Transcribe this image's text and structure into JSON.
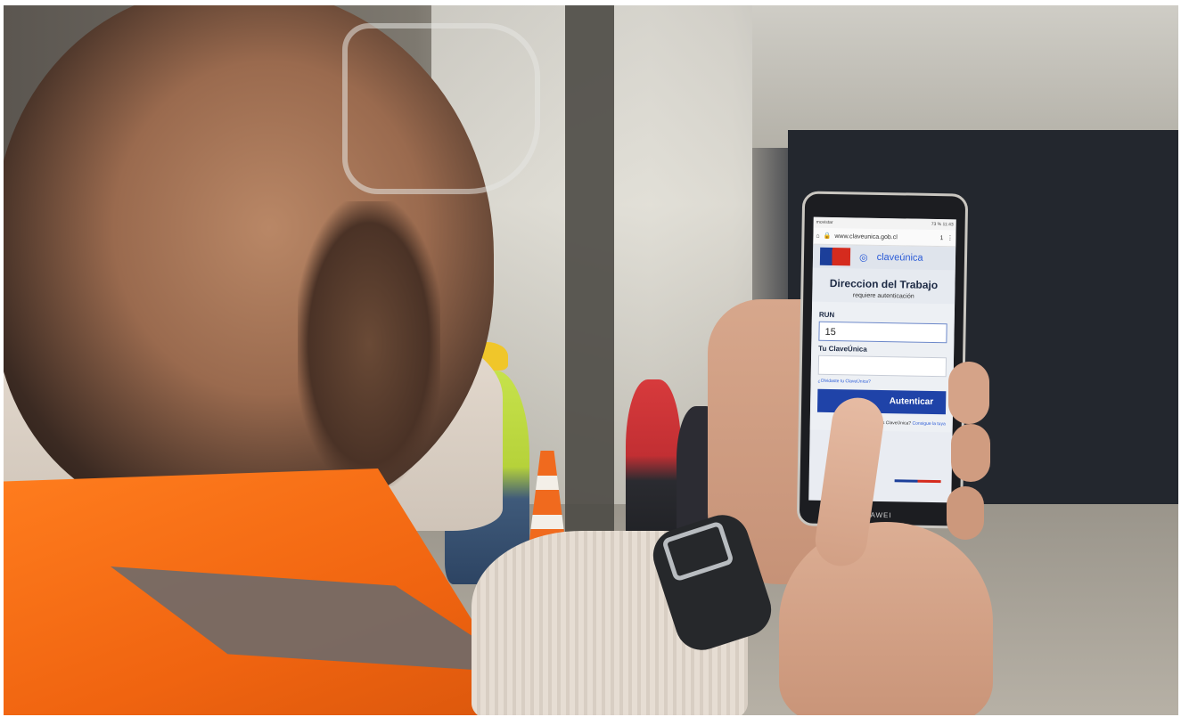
{
  "phone": {
    "brand_text": "HUAWEI",
    "status_left": "movistar",
    "status_right": "73 % 11:43",
    "browser": {
      "url": "www.claveunica.gob.cl",
      "tab_count": "1"
    },
    "site": {
      "brand": "claveúnica",
      "title": "Direccion del Trabajo",
      "subtitle": "requiere autenticación",
      "run_label": "RUN",
      "run_value": "15",
      "clave_label": "Tu ClaveÚnica",
      "forgot_text": "¿Olvidaste tu ClaveÚnica?",
      "submit_label": "Autenticar",
      "no_clave_text": "¿No tienes ClaveÚnica?",
      "get_it_text": "Consigue la tuya"
    }
  },
  "colors": {
    "vest": "#f06410",
    "brand_blue": "#1f43a8",
    "flag_red": "#d52b1e"
  }
}
